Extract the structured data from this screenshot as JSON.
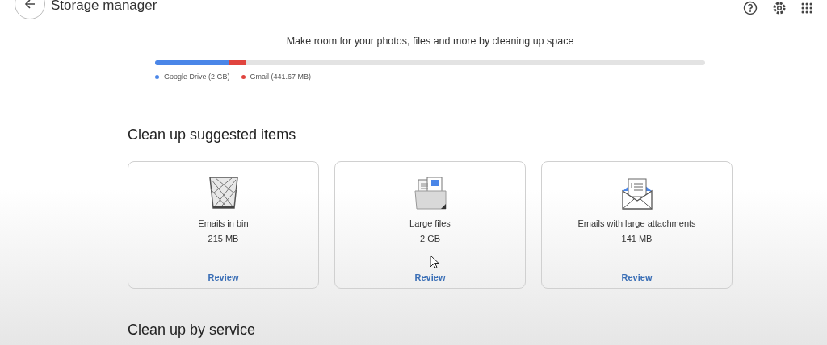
{
  "header": {
    "title": "Storage manager"
  },
  "summary": {
    "text": "Make room for your photos, files and more by cleaning up space",
    "segments": [
      {
        "label": "Google Drive (2 GB)",
        "color": "#4a86e8",
        "level": 0.134
      },
      {
        "label": "Gmail (441.67 MB)",
        "color": "#e0443e"
      }
    ]
  },
  "suggested": {
    "heading": "Clean up suggested items",
    "cards": [
      {
        "kind": "bin",
        "title": "Emails in bin",
        "size": "215 MB",
        "action": "Review"
      },
      {
        "kind": "files",
        "title": "Large files",
        "size": "2 GB",
        "action": "Review"
      },
      {
        "kind": "attachments",
        "title": "Emails with large attachments",
        "size": "141 MB",
        "action": "Review"
      }
    ]
  },
  "by_service": {
    "heading": "Clean up by service"
  }
}
